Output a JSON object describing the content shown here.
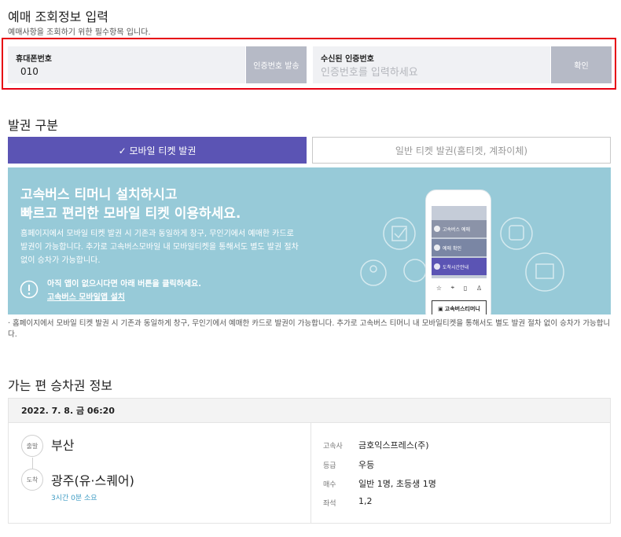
{
  "reservation_lookup": {
    "title": "예매 조회정보 입력",
    "subtitle": "예매사항을 조회하기 위한 필수항목 입니다.",
    "phone_label": "휴대폰번호",
    "phone_value": "010",
    "send_code_button": "인증번호 발송",
    "code_label": "수신된 인증번호",
    "code_placeholder": "인증번호를 입력하세요",
    "confirm_button": "확인"
  },
  "issuance": {
    "title": "발권 구분",
    "tabs": [
      {
        "label": "✓ 모바일 티켓 발권",
        "active": true
      },
      {
        "label": "일반 티켓 발권(홈티켓, 계좌이체)",
        "active": false
      }
    ]
  },
  "banner": {
    "headline_1": "고속버스 티머니 설치하시고",
    "headline_2": "빠르고 편리한 모바일 티켓 이용하세요.",
    "desc_1": "홈페이지에서 모바일 티켓 발권 시 기존과 동일하게 창구, 무인기에서 예매한 카드로",
    "desc_2": "발권이 가능합니다. 추가로 고속버스모바일 내 모바일티켓을 통해서도 별도 발권 절차",
    "desc_3": "없이 승차가 가능합니다.",
    "note": "아직 앱이 없으시다면 아래 버튼을 클릭하세요.",
    "install_link": "고속버스 모바일앱 설치",
    "phone_menu": [
      "고속버스 예매",
      "예매 확인",
      "도착시간안내"
    ],
    "phone_brand": "고속버스티머니"
  },
  "notice": "· 홈페이지에서 모바일 티켓 발권 시 기존과 동일하게 창구, 무인기에서 예매한 카드로 발권이 가능합니다. 추가로 고속버스 티머니 내 모바일티켓을 통해서도 별도 발권 절차 없이 승차가 가능합니다.",
  "ticket_info": {
    "title": "가는 편 승차권 정보",
    "datetime": "2022. 7. 8. 금 06:20",
    "departure_tag": "출발",
    "departure": "부산",
    "arrival_tag": "도착",
    "arrival": "광주(유·스퀘어)",
    "duration": "3시간 0분 소요",
    "details": [
      {
        "label": "고속사",
        "value": "금호익스프레스(주)"
      },
      {
        "label": "등급",
        "value": "우등"
      },
      {
        "label": "매수",
        "value": "일반 1명, 초등생 1명"
      },
      {
        "label": "좌석",
        "value": "1,2"
      }
    ]
  },
  "colors": {
    "accent": "#5b54b4",
    "banner": "#97cad8",
    "highlight_border": "#e60012",
    "button_gray": "#b6bac6",
    "link": "#3f9cc4"
  }
}
